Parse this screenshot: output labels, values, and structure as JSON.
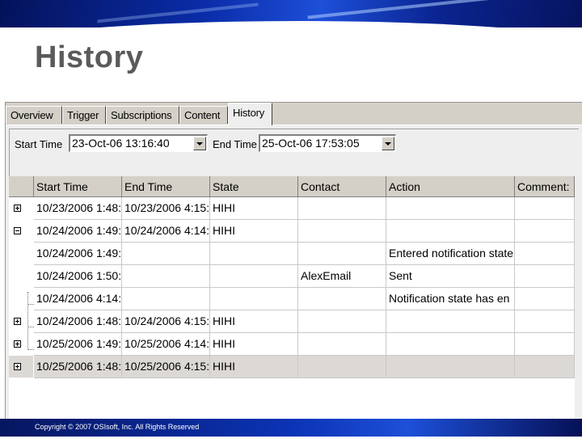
{
  "slide": {
    "title": "History",
    "copyright": "Copyright © 2007 OSIsoft, Inc. All Rights Reserved"
  },
  "tabs": [
    {
      "label": "Overview",
      "active": false
    },
    {
      "label": "Trigger",
      "active": false
    },
    {
      "label": "Subscriptions",
      "active": false
    },
    {
      "label": "Content",
      "active": false
    },
    {
      "label": "History",
      "active": true
    }
  ],
  "filter": {
    "start_label": "Start Time",
    "start_value": "23-Oct-06 13:16:40",
    "end_label": "End Time",
    "end_value": "25-Oct-06 17:53:05"
  },
  "grid": {
    "columns": [
      "Start Time",
      "End Time",
      "State",
      "Contact",
      "Action",
      "Comment:"
    ],
    "rows": [
      {
        "expander": "plus",
        "child": false,
        "selected": false,
        "cells": [
          "10/23/2006 1:48:",
          "10/23/2006 4:15:",
          "HIHI",
          "",
          "",
          ""
        ]
      },
      {
        "expander": "minus",
        "child": false,
        "selected": false,
        "cells": [
          "10/24/2006 1:49:",
          "10/24/2006 4:14:",
          "HIHI",
          "",
          "",
          ""
        ]
      },
      {
        "expander": "none",
        "child": true,
        "selected": false,
        "cells": [
          "10/24/2006 1:49:",
          "",
          "",
          "",
          "Entered notification state",
          ""
        ]
      },
      {
        "expander": "none",
        "child": true,
        "selected": false,
        "cells": [
          "10/24/2006 1:50:",
          "",
          "",
          "AlexEmail",
          "Sent",
          ""
        ]
      },
      {
        "expander": "none",
        "child": true,
        "selected": false,
        "cells": [
          "10/24/2006 4:14:",
          "",
          "",
          "",
          "Notification state has en",
          ""
        ]
      },
      {
        "expander": "plus",
        "child": false,
        "selected": false,
        "cells": [
          "10/24/2006 1:48:",
          "10/24/2006 4:15:",
          "HIHI",
          "",
          "",
          ""
        ]
      },
      {
        "expander": "plus",
        "child": false,
        "selected": false,
        "cells": [
          "10/25/2006 1:49:",
          "10/25/2006 4:14:",
          "HIHI",
          "",
          "",
          ""
        ]
      },
      {
        "expander": "plus",
        "child": false,
        "selected": true,
        "cells": [
          "10/25/2006 1:48:",
          "10/25/2006 4:15:",
          "HIHI",
          "",
          "",
          ""
        ]
      }
    ]
  }
}
